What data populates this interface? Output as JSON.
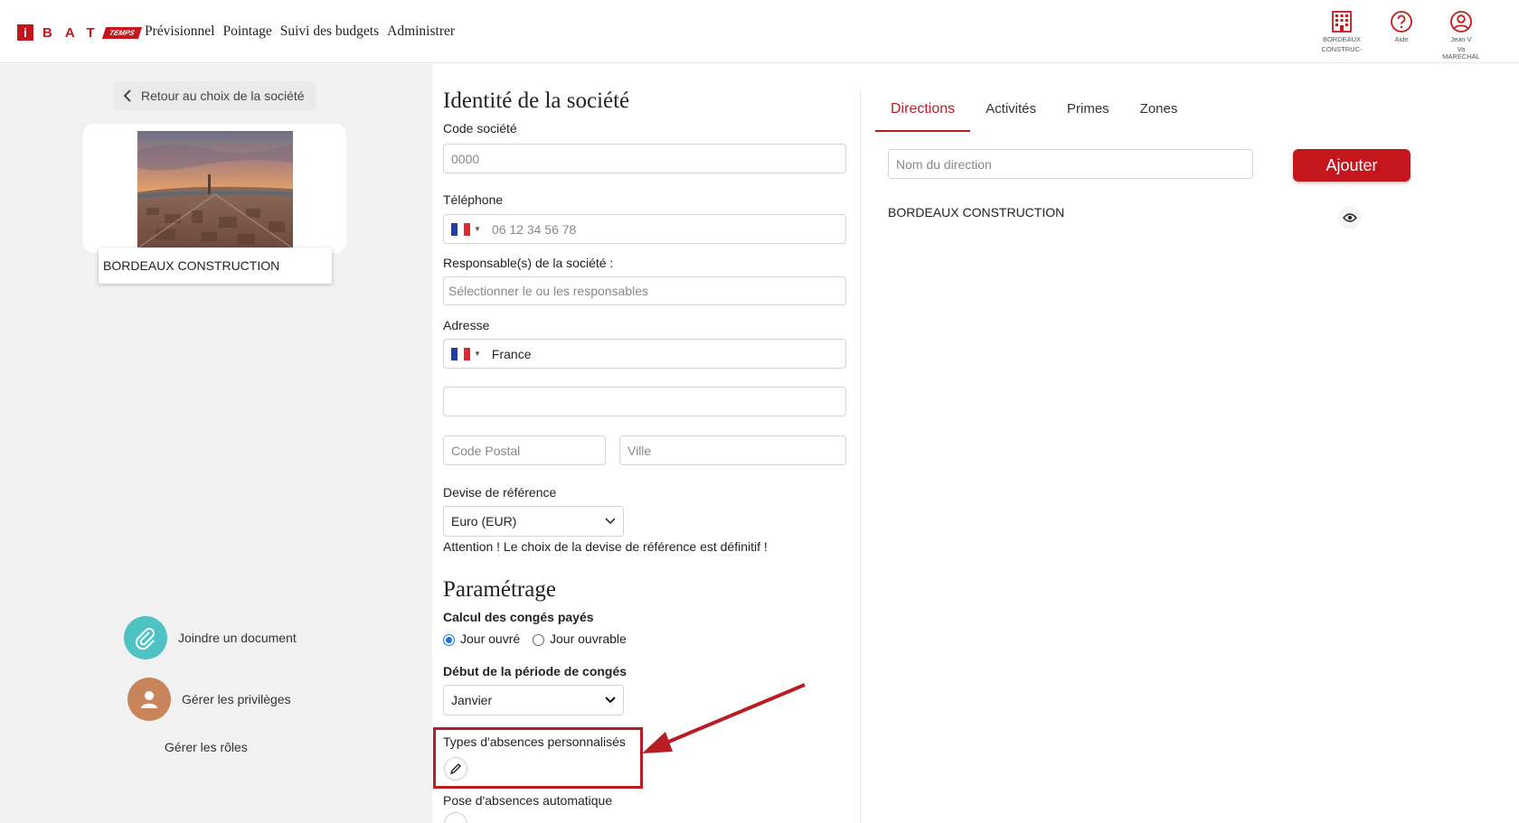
{
  "header": {
    "logo_i": "i",
    "logo_text": "BAT",
    "logo_tag": "TEMPS",
    "nav": [
      "Prévisionnel",
      "Pointage",
      "Suivi des budgets",
      "Administrer"
    ],
    "icons": [
      {
        "name": "building-icon",
        "caption1": "BORDEAUX",
        "caption2": "CONSTRUC-"
      },
      {
        "name": "help-icon",
        "caption1": "Aide",
        "caption2": ""
      },
      {
        "name": "user-icon",
        "caption1": "Jean V",
        "caption2": "Va MARECHAL"
      }
    ]
  },
  "left": {
    "back_label": "Retour au choix de la société",
    "company_name": "BORDEAUX CONSTRUCTION",
    "actions": {
      "join_doc": "Joindre un document",
      "privileges": "Gérer les privilèges",
      "roles": "Gérer les rôles"
    }
  },
  "identity": {
    "title": "Identité de la société",
    "code_label": "Code société",
    "code_placeholder": "0000",
    "phone_label": "Téléphone",
    "phone_placeholder": "06 12 34 56 78",
    "resp_label": "Responsable(s) de la société :",
    "resp_placeholder": "Sélectionner le ou les responsables",
    "address_label": "Adresse",
    "country": "France",
    "postal_placeholder": "Code Postal",
    "city_placeholder": "Ville",
    "currency_label": "Devise de référence",
    "currency_value": "Euro (EUR)",
    "currency_warning": "Attention ! Le choix de la devise de référence est définitif !"
  },
  "params": {
    "title": "Paramétrage",
    "leave_calc_label": "Calcul des congés payés",
    "radio_open": "Jour ouvré",
    "radio_working": "Jour ouvrable",
    "leave_start_label": "Début de la période de congés",
    "leave_start_value": "Janvier",
    "custom_absences_label": "Types d'absences personnalisés",
    "auto_absences_label": "Pose d'absences automatique"
  },
  "right": {
    "tabs": [
      "Directions",
      "Activités",
      "Primes",
      "Zones"
    ],
    "direction_placeholder": "Nom du direction",
    "add_label": "Ajouter",
    "directions": [
      "BORDEAUX CONSTRUCTION"
    ]
  },
  "colors": {
    "brand": "#c4161c",
    "highlight": "#b81d24",
    "radio": "#1a73e8"
  }
}
